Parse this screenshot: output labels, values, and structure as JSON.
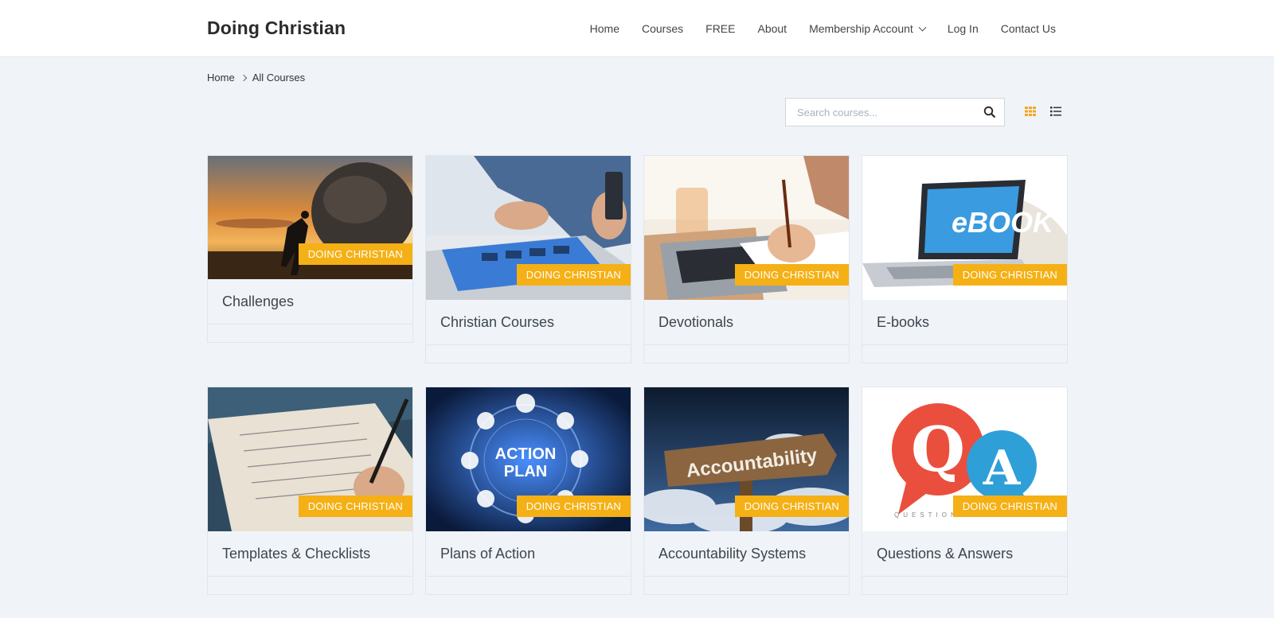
{
  "site": {
    "title": "Doing Christian"
  },
  "nav": {
    "items": [
      "Home",
      "Courses",
      "FREE",
      "About",
      "Membership Account",
      "Log In",
      "Contact Us"
    ]
  },
  "breadcrumb": {
    "home": "Home",
    "current": "All Courses"
  },
  "search": {
    "placeholder": "Search courses...",
    "value": ""
  },
  "view_toggle": {
    "grid_icon": "grid-icon",
    "list_icon": "list-icon",
    "active": "grid",
    "active_color": "#f5a623"
  },
  "colors": {
    "accent": "#f5b015",
    "background": "#f0f4f8"
  },
  "cards": [
    {
      "title": "Challenges",
      "badge": "DOING CHRISTIAN",
      "image": "man pushing boulder at sunset"
    },
    {
      "title": "Christian Courses",
      "badge": "DOING CHRISTIAN",
      "image": "hands on tablet with phone"
    },
    {
      "title": "Devotionals",
      "badge": "DOING CHRISTIAN",
      "image": "writing notes beside laptop"
    },
    {
      "title": "E-books",
      "badge": "DOING CHRISTIAN",
      "image": "laptop with eBook and open book"
    },
    {
      "title": "Templates & Checklists",
      "badge": "DOING CHRISTIAN",
      "image": "hand writing checklist in notebook"
    },
    {
      "title": "Plans of Action",
      "badge": "DOING CHRISTIAN",
      "image": "action plan digital interface"
    },
    {
      "title": "Accountability Systems",
      "badge": "DOING CHRISTIAN",
      "image": "wooden accountability sign and clouds"
    },
    {
      "title": "Questions & Answers",
      "badge": "DOING CHRISTIAN",
      "image": "Q and A speech bubbles"
    }
  ],
  "thumb_text": {
    "ebook": "eBOOK",
    "action": "ACTION",
    "plan": "PLAN",
    "accountability": "Accountability",
    "q": "Q",
    "a": "A",
    "qa_caption": "QUESTIONS & ANSWERS"
  }
}
